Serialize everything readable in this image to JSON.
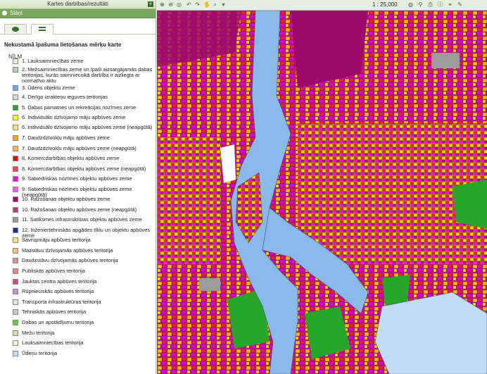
{
  "left_panel": {
    "title": "Kartes darbības/rezultāti",
    "collapse_icon": "double-arrow-left-icon",
    "layers_header": "Slāņi",
    "layers_icon": "layers-icon",
    "tabs": [
      {
        "icon": "layers-stack-icon",
        "active": false
      },
      {
        "icon": "list-icon",
        "active": true
      }
    ],
    "legend_title": "Nekustamā īpašuma lietošanas mērķu karte",
    "legend_subtitle": "NĪLM",
    "items": [
      {
        "label": "1. Lauksaimniecības zeme",
        "color": "#e4f0d6"
      },
      {
        "label": "2. Mežsaimniecības zeme un īpaši aizsargājamās dabas teritorijas, kurās saimnieciskā darbība ir aizliegta ar normatīvo aktu",
        "color": "#b2d6a0"
      },
      {
        "label": "3. Ūdens objektu zeme",
        "color": "#6ea9e7"
      },
      {
        "label": "4. Derīgo izrakteņu ieguves teritorijas",
        "color": "#d9d9d9"
      },
      {
        "label": "5. Dabas pamatnes un rekreācijas nozīmes zeme",
        "color": "#27a62a"
      },
      {
        "label": "6. Individuālo dzīvojamo māju apbūves zeme",
        "color": "#ffff00"
      },
      {
        "label": "6. Individuālo dzīvojamo māju apbūves zeme (neapgūtā)",
        "color": "#f5e87a"
      },
      {
        "label": "7. Daudzdzīvokļu māju apbūves zeme",
        "color": "#ffa500"
      },
      {
        "label": "7. Daudzdzīvokļu māju apbūves zeme (neapgūtā)",
        "color": "#f9b84c"
      },
      {
        "label": "8. Komercdarbības objektu apbūves zeme",
        "color": "#ff0000"
      },
      {
        "label": "8. Komercdarbības objektu apbūves zeme (neapgūtā)",
        "color": "#f24a4a"
      },
      {
        "label": "9. Sabiedriskas nozīmes objektu apbūves zeme",
        "color": "#ff00ff"
      },
      {
        "label": "9. Sabiedriskas nozīmes objektu apbūves zeme (neapgūtā)",
        "color": "#f55ef5"
      },
      {
        "label": "10. Ražošanas objektu apbūves zeme",
        "color": "#9c0a6b"
      },
      {
        "label": "10. Ražošanas objektu apbūves zeme (neapgūtā)",
        "color": "#b0407e"
      },
      {
        "label": "11. Satiksmes infrastruktūras objektu apbūves zeme",
        "color": "#9b9b9b"
      },
      {
        "label": "12. Inženiertehniskās apgādes tīklu un objektu apbūves zeme",
        "color": "#1e2f9a"
      },
      {
        "label": "Savrupmāju apbūves teritorija",
        "color": "#fbe38a"
      },
      {
        "label": "Mazstāvu dzīvojamās apbūves teritorija",
        "color": "#f9c07e"
      },
      {
        "label": "Daudzstāvu dzīvojamās apbūves teritorija",
        "color": "#d9967a"
      },
      {
        "label": "Publiskās apbūves teritorija",
        "color": "#f07f8e"
      },
      {
        "label": "Jauktas centra apbūves teritorija",
        "color": "#c9488f"
      },
      {
        "label": "Rūpnieciskās apbūves teritorija",
        "color": "#c394d6"
      },
      {
        "label": "Transporta infrastruktūras teritorija",
        "color": "#e3e3e3"
      },
      {
        "label": "Tehniskās apbūves teritorija",
        "color": "#c8c8c8"
      },
      {
        "label": "Dabas un apstādījumu teritorija",
        "color": "#5fd13b"
      },
      {
        "label": "Mežu teritorija",
        "color": "#c9e7a4"
      },
      {
        "label": "Lauksaimniecības teritorija",
        "color": "#f6f0c8"
      },
      {
        "label": "Ūdeņu teritorija",
        "color": "#c2dcf5"
      }
    ]
  },
  "toolbar": {
    "icons": [
      "zoom-in-icon",
      "zoom-out-icon",
      "zoom-extent-icon",
      "back-icon",
      "forward-icon",
      "pan-hand-icon",
      "search-icon",
      "dropdown-arrow-icon",
      "globe-icon",
      "measure-icon",
      "print-icon",
      "info-icon",
      "link-icon",
      "edit-icon"
    ],
    "scale_label": "1 : 25,000"
  },
  "colors": {
    "panel_header": "#77a85b",
    "river": "#8bb9ea",
    "urban_base": "#c9138f"
  }
}
